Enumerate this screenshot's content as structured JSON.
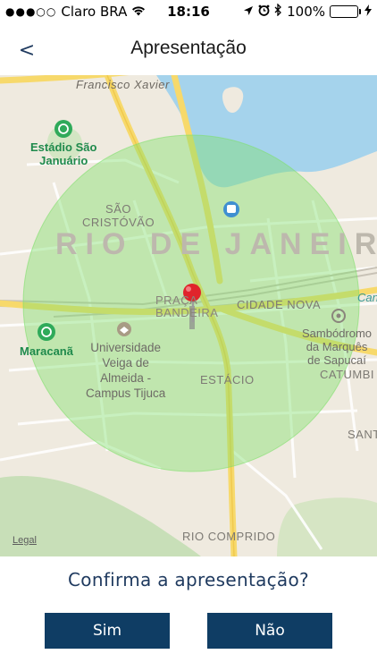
{
  "status_bar": {
    "signal": "●●●○○",
    "carrier": "Claro BRA",
    "wifi_icon": "wifi-icon",
    "time": "18:16",
    "location_icon": "location-arrow-icon",
    "alarm_icon": "alarm-clock-icon",
    "bluetooth_icon": "bluetooth-icon",
    "battery": "100%",
    "charging_icon": "charging-bolt-icon"
  },
  "nav": {
    "back": "<",
    "title": "Apresentação"
  },
  "map": {
    "labels": {
      "francisco_xavier": "Francisco Xavier",
      "estadio_line1": "Estádio São",
      "estadio_line2": "Januário",
      "sao_cristovao_1": "SÃO",
      "sao_cristovao_2": "CRISTÓVÃO",
      "city": "RIO DE JANEIRO",
      "praca_bandeira_1": "PRAÇA",
      "praca_bandeira_2": "BANDEIRA",
      "cidade_nova": "CIDADE NOVA",
      "ca": "Can",
      "maracana": "Maracanã",
      "universidade_1": "Universidade",
      "universidade_2": "Veiga de",
      "universidade_3": "Almeida -",
      "universidade_4": "Campus Tijuca",
      "sambodromo_1": "Sambódromo",
      "sambodromo_2": "da Marquês",
      "sambodromo_3": "de Sapucaí",
      "estacio": "ESTÁCIO",
      "catumbi": "CATUMBI",
      "santa": "SANT",
      "rio_comprido": "RIO COMPRIDO"
    },
    "legal": "Legal",
    "radius_color": "#7ee06b",
    "pin_color": "#e0242b"
  },
  "confirm": {
    "question": "Confirma a apresentação?",
    "yes": "Sim",
    "no": "Não"
  },
  "colors": {
    "primary": "#0f3d64",
    "title_text": "#1f3a5f"
  }
}
